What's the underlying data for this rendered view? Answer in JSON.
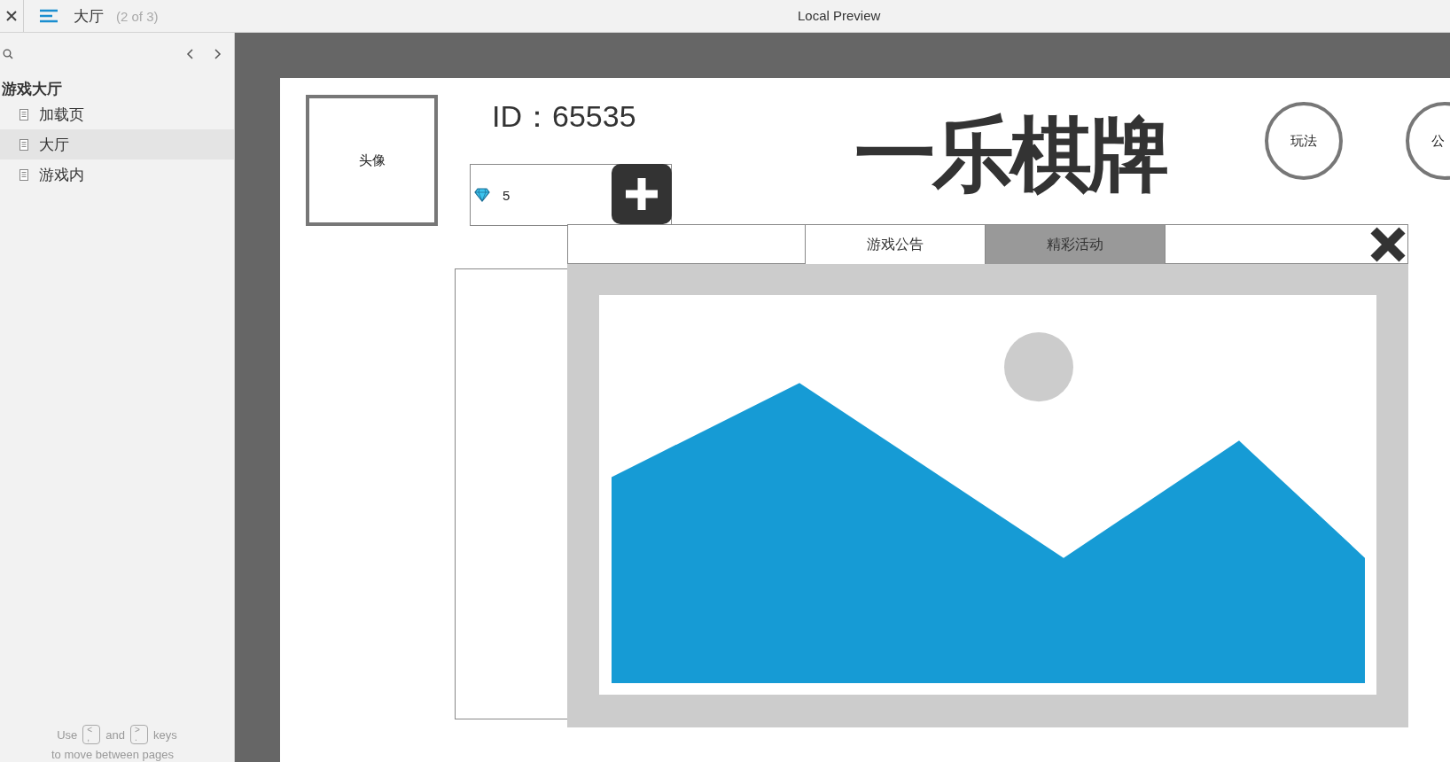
{
  "toolbar": {
    "page_title": "大厅",
    "page_count": "(2 of 3)",
    "preview_title": "Local Preview"
  },
  "sidebar": {
    "group": "游戏大厅",
    "items": [
      {
        "label": "加载页",
        "selected": false
      },
      {
        "label": "大厅",
        "selected": true
      },
      {
        "label": "游戏内",
        "selected": false
      }
    ],
    "hint": [
      {
        "kind": "word",
        "text": "Use"
      },
      {
        "kind": "key",
        "top": "<",
        "bottom": ","
      },
      {
        "kind": "word",
        "text": "and"
      },
      {
        "kind": "key",
        "top": ">",
        "bottom": "."
      },
      {
        "kind": "word",
        "text": "keys"
      }
    ],
    "hint_line2": "to move between pages"
  },
  "canvas": {
    "avatar_label": "头像",
    "user_id": "ID：65535",
    "gems": "5",
    "logo": "一乐棋牌",
    "round_buttons": [
      "玩法",
      "公"
    ],
    "dialog": {
      "tabs": [
        {
          "label": "游戏公告",
          "selected": false
        },
        {
          "label": "精彩活动",
          "selected": true
        }
      ]
    }
  }
}
